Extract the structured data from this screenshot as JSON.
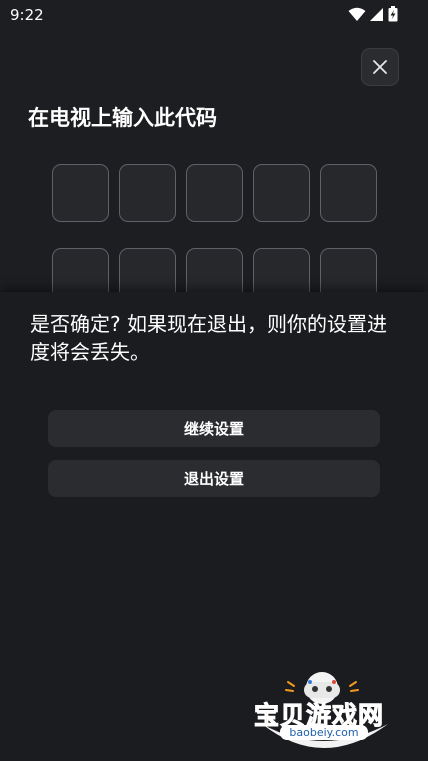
{
  "status_bar": {
    "time": "9:22",
    "icons": [
      "wifi-icon",
      "signal-icon",
      "battery-charging-icon"
    ]
  },
  "pairing": {
    "title": "在电视上输入此代码",
    "code_rows": [
      [
        "",
        "",
        "",
        "",
        ""
      ],
      [
        "",
        "",
        "",
        "",
        ""
      ]
    ]
  },
  "dialog": {
    "message": "是否确定? 如果现在退出，则你的设置进度将会丢失。",
    "continue_label": "继续设置",
    "exit_label": "退出设置"
  },
  "watermark": {
    "brand": "宝贝游戏网",
    "url": "baobeiy.com"
  },
  "colors": {
    "background": "#1b1c1f",
    "button": "#2a2c30",
    "code_border": "#5e6168",
    "logo_orange": "#f39a1e"
  }
}
